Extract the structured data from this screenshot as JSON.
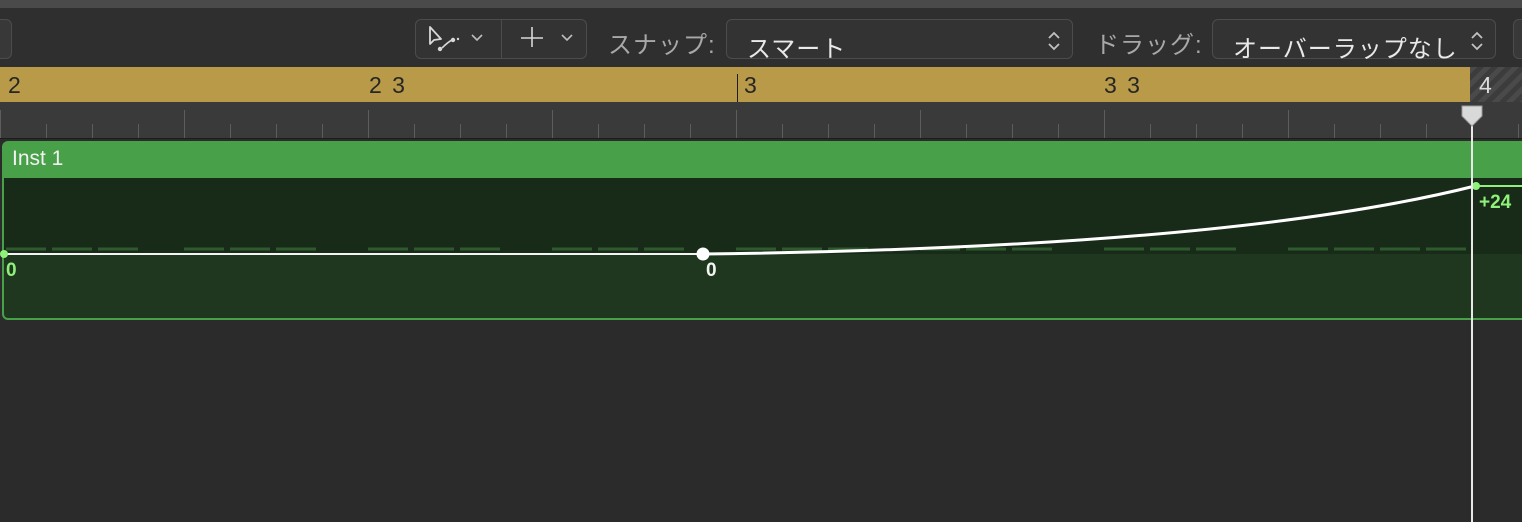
{
  "toolbar": {
    "pointer_tool_icon": "pointer-curve-tool-icon",
    "crosshair_tool_icon": "crosshair-tool-icon",
    "snap_label": "スナップ:",
    "snap_value": "スマート",
    "drag_label": "ドラッグ:",
    "drag_value": "オーバーラップなし"
  },
  "ruler": {
    "bars": [
      "2",
      "2 3",
      "3",
      "3 3",
      "4"
    ]
  },
  "region": {
    "title": "Inst 1",
    "color": "#48a048",
    "automation_points": [
      {
        "label": "0"
      },
      {
        "label": "0"
      },
      {
        "label": "+24"
      }
    ]
  },
  "colors": {
    "ruler": "#b89a48",
    "region_header": "#48a048",
    "region_body": "#1f361f",
    "point_label": "#8ff07a",
    "curve": "#ffffff"
  }
}
